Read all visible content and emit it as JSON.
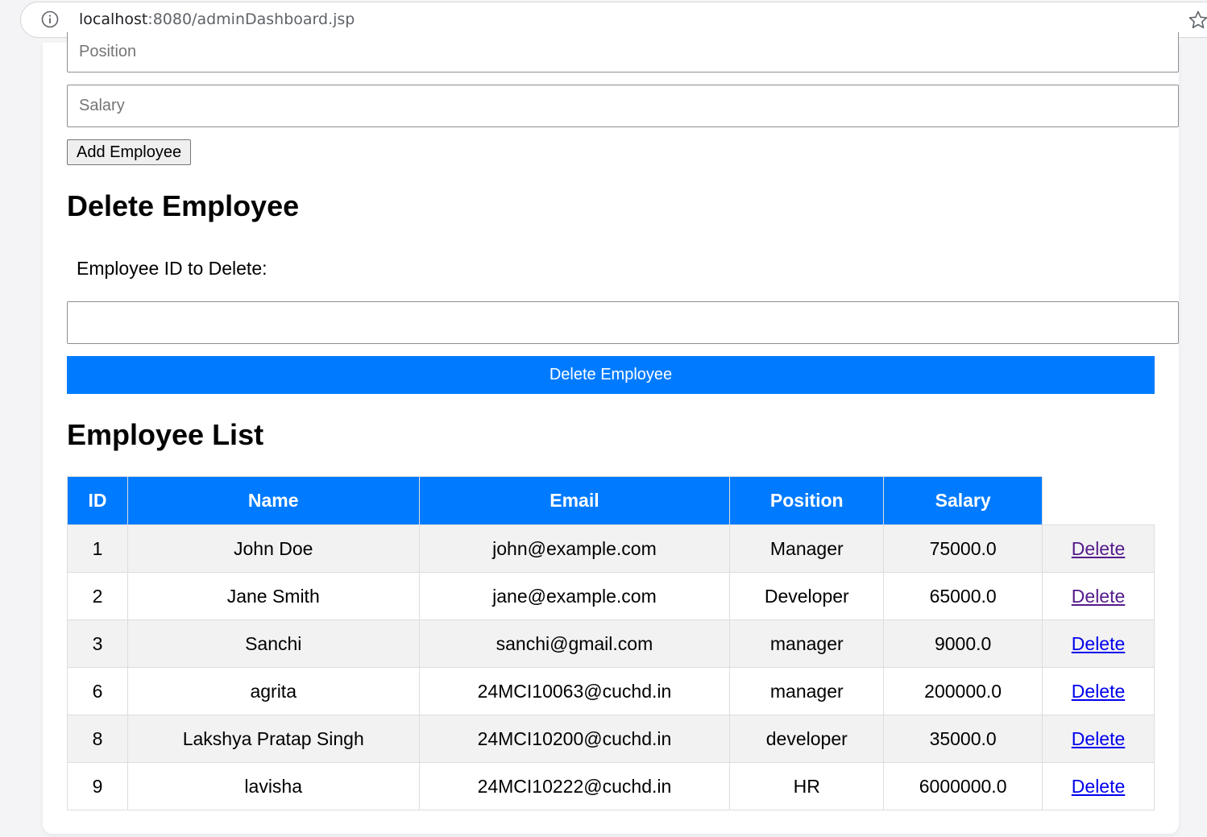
{
  "browser": {
    "url_host": "localhost",
    "url_rest": ":8080/adminDashboard.jsp",
    "info_icon": "info-icon",
    "star_icon": "star-icon"
  },
  "add_form": {
    "position_placeholder": "Position",
    "salary_placeholder": "Salary",
    "add_button_label": "Add Employee"
  },
  "delete_form": {
    "heading": "Delete Employee",
    "id_label": "Employee ID to Delete:",
    "id_value": "",
    "button_label": "Delete Employee"
  },
  "employee_list": {
    "heading": "Employee List",
    "columns": [
      "ID",
      "Name",
      "Email",
      "Position",
      "Salary"
    ],
    "action_label": "Delete",
    "rows": [
      {
        "id": "1",
        "name": "John Doe",
        "email": "john@example.com",
        "position": "Manager",
        "salary": "75000.0",
        "link_visited": true
      },
      {
        "id": "2",
        "name": "Jane Smith",
        "email": "jane@example.com",
        "position": "Developer",
        "salary": "65000.0",
        "link_visited": true
      },
      {
        "id": "3",
        "name": "Sanchi",
        "email": "sanchi@gmail.com",
        "position": "manager",
        "salary": "9000.0",
        "link_visited": false
      },
      {
        "id": "6",
        "name": "agrita",
        "email": "24MCI10063@cuchd.in",
        "position": "manager",
        "salary": "200000.0",
        "link_visited": false
      },
      {
        "id": "8",
        "name": "Lakshya Pratap Singh",
        "email": "24MCI10200@cuchd.in",
        "position": "developer",
        "salary": "35000.0",
        "link_visited": false
      },
      {
        "id": "9",
        "name": "lavisha",
        "email": "24MCI10222@cuchd.in",
        "position": "HR",
        "salary": "6000000.0",
        "link_visited": false
      }
    ]
  },
  "colors": {
    "accent": "#007bff",
    "link": "#0000ee",
    "link_visited": "#551a8b",
    "row_alt": "#f2f2f2"
  }
}
